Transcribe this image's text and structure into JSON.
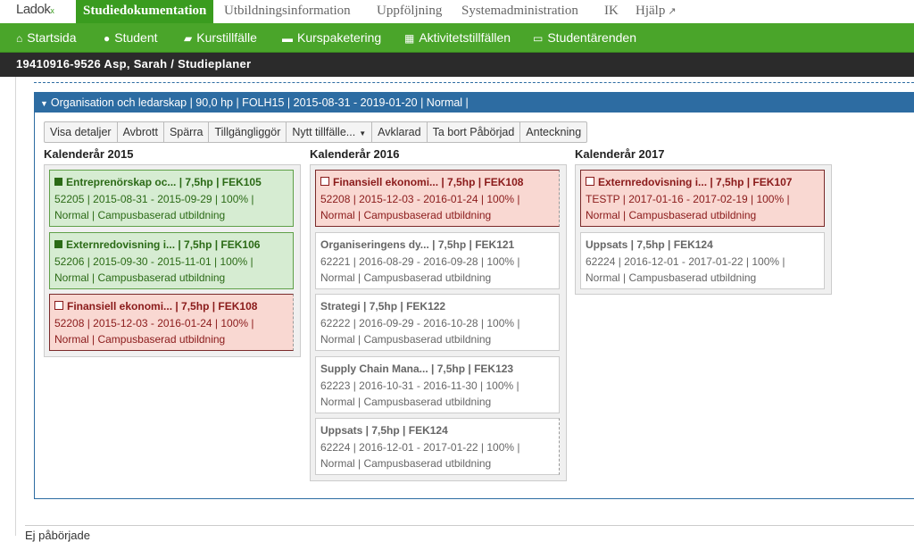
{
  "app": {
    "logo": "Ladok",
    "logo_mark": "x"
  },
  "top_tabs": [
    {
      "label": "Studiedokumentation"
    },
    {
      "label": "Utbildningsinformation"
    },
    {
      "label": "Uppföljning"
    },
    {
      "label": "Systemadministration"
    },
    {
      "label": "IK"
    },
    {
      "label": "Hjälp"
    }
  ],
  "nav": [
    {
      "label": "Startsida",
      "icon": "home-icon"
    },
    {
      "label": "Student",
      "icon": "user-icon"
    },
    {
      "label": "Kurstillfälle",
      "icon": "book-icon"
    },
    {
      "label": "Kurspaketering",
      "icon": "folder-icon"
    },
    {
      "label": "Aktivitetstillfällen",
      "icon": "calendar-icon"
    },
    {
      "label": "Studentärenden",
      "icon": "inbox-icon"
    }
  ],
  "student_bar": "19410916-9526 Asp, Sarah / Studieplaner",
  "panel_title": "Organisation och ledarskap | 90,0 hp | FOLH15 | 2015-08-31 - 2019-01-20 | Normal |",
  "buttons": [
    "Visa detaljer",
    "Avbrott",
    "Spärra",
    "Tillgängliggör",
    "Nytt tillfälle...",
    "Avklarad",
    "Ta bort Påbörjad",
    "Anteckning"
  ],
  "years": [
    {
      "label": "Kalenderår 2015",
      "courses": [
        {
          "title": "Entreprenörskap oc... | 7,5hp | FEK105",
          "line2": "52205 | 2015-08-31 - 2015-09-29 | 100% |",
          "line3": "Normal | Campusbaserad utbildning",
          "status": "green"
        },
        {
          "title": "Externredovisning i... | 7,5hp | FEK106",
          "line2": "52206 | 2015-09-30 - 2015-11-01 | 100% |",
          "line3": "Normal | Campusbaserad utbildning",
          "status": "green"
        },
        {
          "title": "Finansiell ekonomi... | 7,5hp | FEK108",
          "line2": "52208 | 2015-12-03 - 2016-01-24 | 100% |",
          "line3": "Normal | Campusbaserad utbildning",
          "status": "red"
        }
      ]
    },
    {
      "label": "Kalenderår 2016",
      "courses": [
        {
          "title": "Finansiell ekonomi... | 7,5hp | FEK108",
          "line2": "52208 | 2015-12-03 - 2016-01-24 | 100% |",
          "line3": "Normal | Campusbaserad utbildning",
          "status": "red"
        },
        {
          "title": "Organiseringens dy... | 7,5hp | FEK121",
          "line2": "62221 | 2016-08-29 - 2016-09-28 | 100% |",
          "line3": "Normal | Campusbaserad utbildning",
          "status": "grey"
        },
        {
          "title": "Strategi | 7,5hp | FEK122",
          "line2": "62222 | 2016-09-29 - 2016-10-28 | 100% |",
          "line3": "Normal | Campusbaserad utbildning",
          "status": "grey"
        },
        {
          "title": "Supply Chain Mana... | 7,5hp | FEK123",
          "line2": "62223 | 2016-10-31 - 2016-11-30 | 100% |",
          "line3": "Normal | Campusbaserad utbildning",
          "status": "grey"
        },
        {
          "title": "Uppsats | 7,5hp | FEK124",
          "line2": "62224 | 2016-12-01 - 2017-01-22 | 100% |",
          "line3": "Normal | Campusbaserad utbildning",
          "status": "grey"
        }
      ]
    },
    {
      "label": "Kalenderår 2017",
      "courses": [
        {
          "title": "Externredovisning i... | 7,5hp | FEK107",
          "line2": "TESTP | 2017-01-16 - 2017-02-19 | 100% |",
          "line3": "Normal | Campusbaserad utbildning",
          "status": "red"
        },
        {
          "title": "Uppsats | 7,5hp | FEK124",
          "line2": "62224 | 2016-12-01 - 2017-01-22 | 100% |",
          "line3": "Normal | Campusbaserad utbildning",
          "status": "grey"
        }
      ]
    }
  ],
  "bottom_text": "Ej påbörjade",
  "colors": {
    "brand_green": "#4aa52a",
    "active_tab": "#3a9c1f",
    "panel_blue": "#2d6ca2",
    "done_bg": "#d6ecd2",
    "ongoing_bg": "#f9d8d2"
  }
}
